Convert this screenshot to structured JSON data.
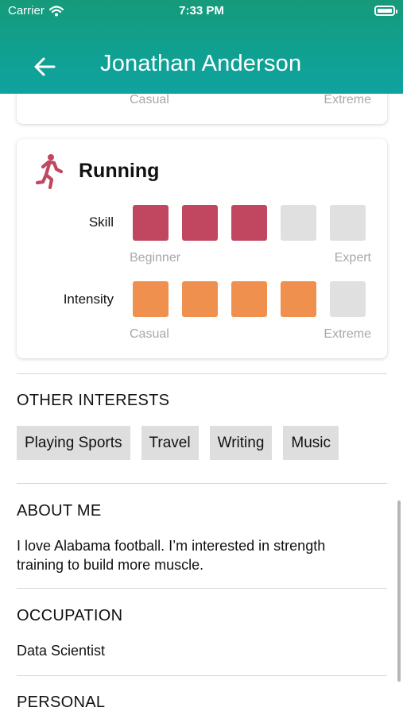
{
  "status_bar": {
    "carrier": "Carrier",
    "time": "7:33 PM"
  },
  "header": {
    "title": "Jonathan Anderson"
  },
  "previous_card": {
    "low_label": "Casual",
    "high_label": "Extreme"
  },
  "activity": {
    "name": "Running",
    "skill": {
      "label": "Skill",
      "level": 3,
      "max": 5,
      "low_label": "Beginner",
      "high_label": "Expert",
      "color": "#c0475f"
    },
    "intensity": {
      "label": "Intensity",
      "level": 4,
      "max": 5,
      "low_label": "Casual",
      "high_label": "Extreme",
      "color": "#f0904f"
    }
  },
  "other_interests": {
    "title": "OTHER INTERESTS",
    "chips": [
      "Playing Sports",
      "Travel",
      "Writing",
      "Music"
    ]
  },
  "about_me": {
    "title": "ABOUT ME",
    "text": "I love Alabama football. I’m interested in strength training to build more muscle."
  },
  "occupation": {
    "title": "OCCUPATION",
    "value": "Data Scientist"
  },
  "personal": {
    "title": "PERSONAL"
  },
  "colors": {
    "header_top": "#169a7a",
    "header_bottom": "#0fa3a0",
    "chip_bg": "#dedede"
  },
  "icons": {
    "back": "arrow-left-icon",
    "activity": "running-person-icon",
    "wifi": "wifi-icon",
    "battery": "battery-icon"
  }
}
